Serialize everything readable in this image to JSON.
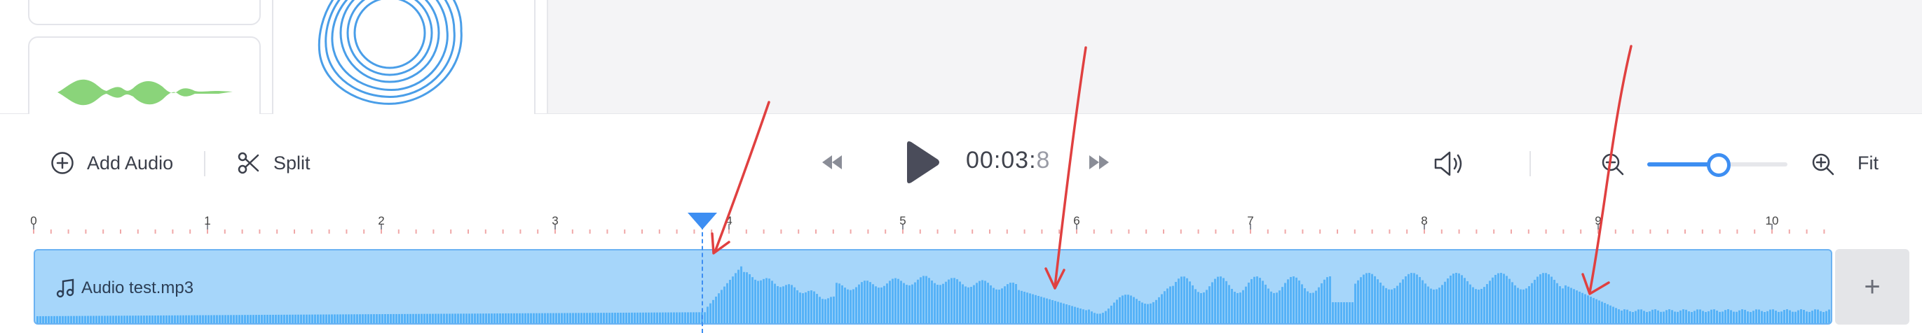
{
  "toolbar": {
    "add_audio_label": "Add Audio",
    "split_label": "Split",
    "time_main": "00:03:",
    "time_fraction": "8",
    "fit_label": "Fit"
  },
  "zoom": {
    "level_fraction": 0.5
  },
  "timeline": {
    "ticks": [
      "0",
      "1",
      "2",
      "3",
      "4",
      "5",
      "6",
      "7",
      "8",
      "9",
      "10"
    ],
    "playhead_seconds": 3.85
  },
  "track": {
    "name": "Audio test.mp3"
  },
  "add_track_label": "+",
  "colors": {
    "accent": "#3d8ef2",
    "track_fill": "#a6d6fa",
    "waveform": "#56b2f7",
    "annotation": "#e04040",
    "green_wave": "#8ad47a"
  },
  "icons": [
    "add-circle-icon",
    "scissors-icon",
    "rewind-icon",
    "play-icon",
    "fast-forward-icon",
    "volume-icon",
    "zoom-out-icon",
    "zoom-in-icon",
    "music-note-icon",
    "plus-icon"
  ]
}
